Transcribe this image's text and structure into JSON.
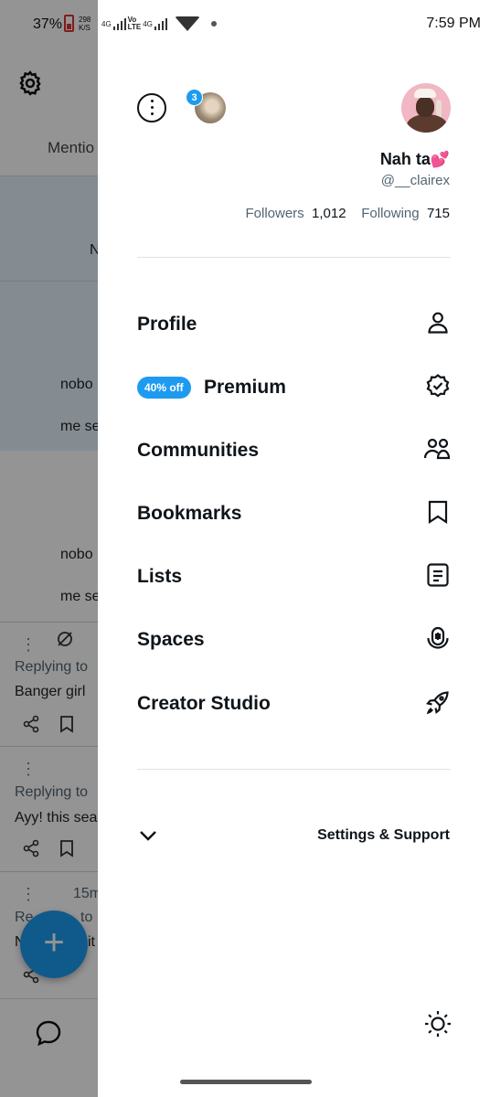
{
  "background_app": {
    "status_battery": "37%",
    "status_speed_value": "298",
    "status_speed_unit": "K/S",
    "tab_fragment": "Mentio",
    "letter_fragment": "N",
    "text_fragments": [
      "nobo",
      "me se",
      "nobo",
      "me se"
    ],
    "replying_1": "Replying to",
    "reply_text_1": "Banger girl",
    "replying_2": "Replying to",
    "reply_text_2": "Ayy! this sea",
    "time_fragment": "15m",
    "replying_3": "Re",
    "replying_3b": "to",
    "reply_text_3": "N",
    "reply_text_3b": "it",
    "fab_label": "+"
  },
  "status_bar": {
    "time": "7:59 PM",
    "net_1": "4G",
    "volte_top": "Vo",
    "volte_bottom": "LTE",
    "net_2": "4G"
  },
  "header": {
    "notification_count": "3",
    "display_name": "Nah ta",
    "name_emoji": "💕",
    "handle": "@__clairex",
    "followers_label": "Followers",
    "followers_count": "1,012",
    "following_label": "Following",
    "following_count": "715"
  },
  "menu": {
    "profile": "Profile",
    "premium_badge": "40% off",
    "premium": "Premium",
    "communities": "Communities",
    "bookmarks": "Bookmarks",
    "lists": "Lists",
    "spaces": "Spaces",
    "creator_studio": "Creator Studio"
  },
  "footer": {
    "settings_support": "Settings & Support"
  },
  "icons": {
    "more": "more-options-icon",
    "profile": "person-icon",
    "premium": "verified-badge-icon",
    "communities": "people-icon",
    "bookmarks": "bookmark-icon",
    "lists": "list-icon",
    "spaces": "spaces-mic-icon",
    "creator_studio": "rocket-icon",
    "settings": "chevron-down-icon",
    "display": "sun-icon"
  },
  "colors": {
    "accent": "#1d9bf0",
    "text": "#0f1419",
    "muted": "#536471"
  }
}
